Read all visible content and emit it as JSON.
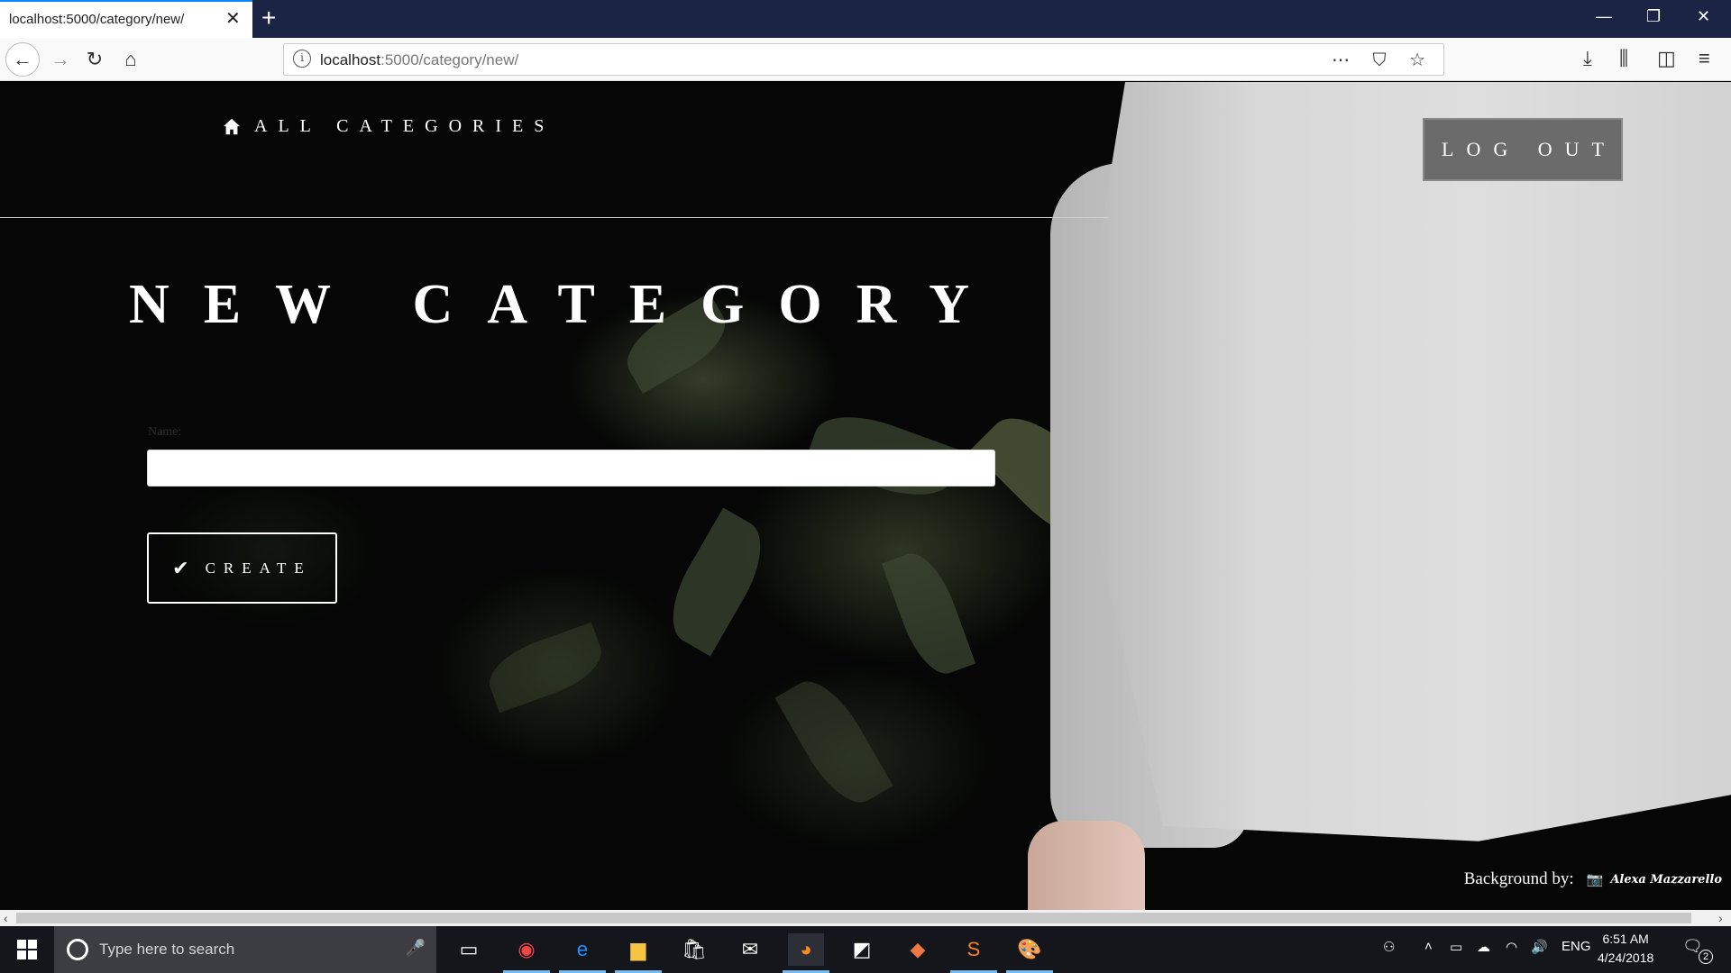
{
  "browser": {
    "tab_title": "localhost:5000/category/new/",
    "url_host": "localhost",
    "url_rest": ":5000/category/new/"
  },
  "header": {
    "home_label": "ALL CATEGORIES",
    "logout_label": "LOG OUT"
  },
  "main": {
    "title": "NEW CATEGORY",
    "name_label": "Name:",
    "name_value": "",
    "create_label": "CREATE"
  },
  "footer": {
    "credit_label": "Background by:",
    "credit_name": "Alexa Mazzarello"
  },
  "taskbar": {
    "search_placeholder": "Type here to search",
    "language": "ENG",
    "time": "6:51 AM",
    "date": "4/24/2018",
    "notification_count": "2"
  },
  "colors": {
    "accent": "#0a84ff",
    "tabbar": "#1b2445",
    "logout_bg": "#6b6b6b",
    "taskbar": "#14161c"
  }
}
